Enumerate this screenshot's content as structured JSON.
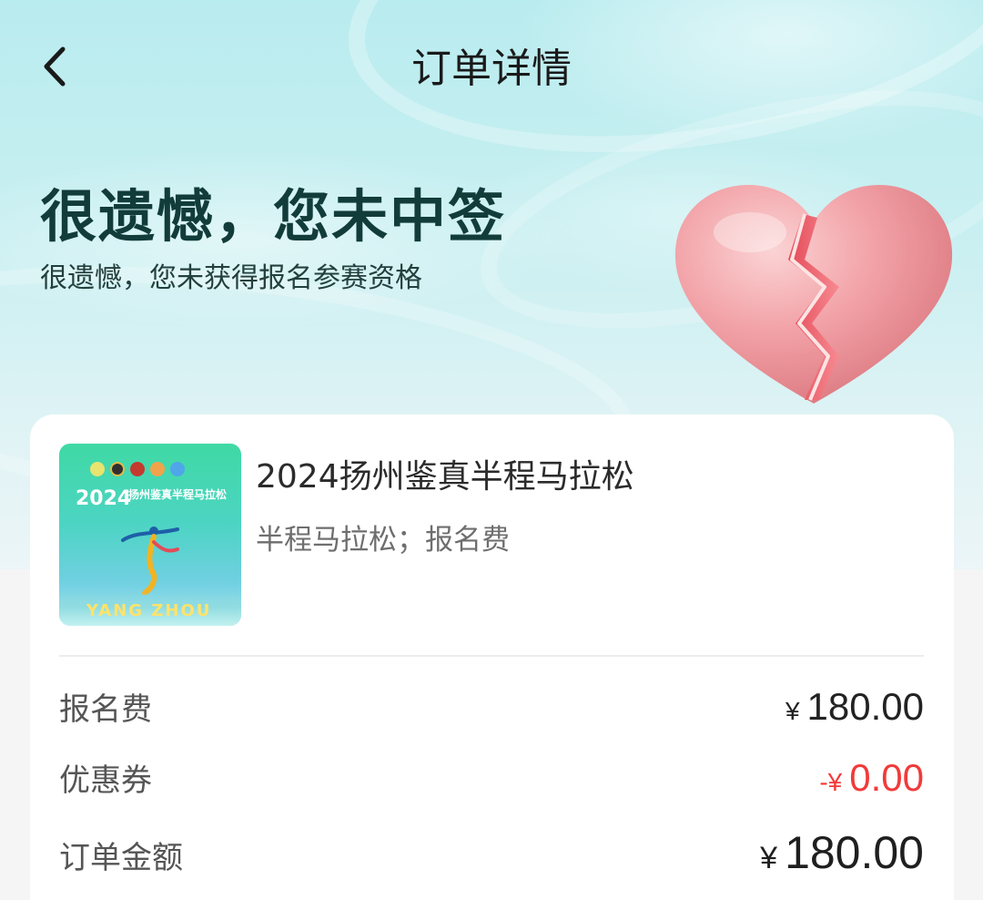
{
  "header": {
    "title": "订单详情"
  },
  "result": {
    "headline": "很遗憾，您未中签",
    "subline": "很遗憾，您未获得报名参赛资格"
  },
  "order_item": {
    "name": "2024扬州鉴真半程马拉松",
    "description": "半程马拉松；报名费",
    "poster": {
      "year": "2024",
      "title": "扬州鉴真半程马拉松",
      "city": "YANG ZHOU"
    }
  },
  "summary": {
    "currency": "¥",
    "rows": [
      {
        "label": "报名费",
        "prefix": "",
        "amount": "180.00"
      },
      {
        "label": "优惠券",
        "prefix": "-",
        "amount": "0.00"
      },
      {
        "label": "订单金额",
        "prefix": "",
        "amount": "180.00"
      }
    ]
  },
  "colors": {
    "accent_dark": "#123c39",
    "discount_red": "#f23a3a",
    "heart_pink": "#f2a3a8"
  },
  "icons": {
    "back": "chevron-left-icon",
    "status": "broken-heart-icon"
  }
}
